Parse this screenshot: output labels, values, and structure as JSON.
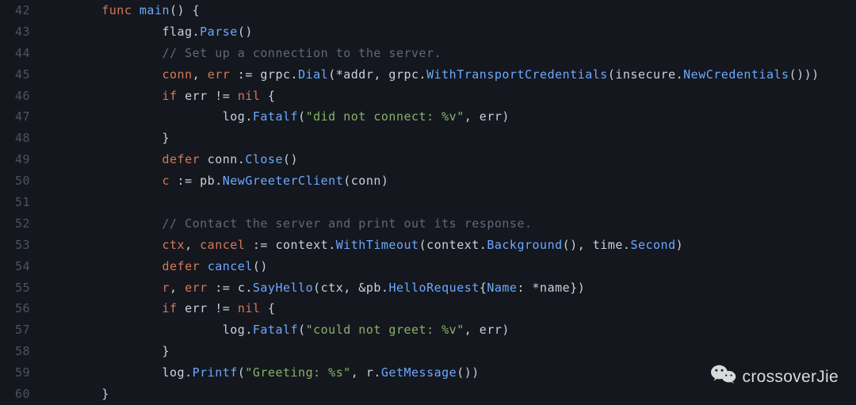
{
  "watermark": {
    "text": "crossoverJie"
  },
  "gutter": {
    "start": 42,
    "end": 60
  },
  "code": {
    "lines": [
      {
        "n": 42,
        "indent": 1,
        "tokens": [
          [
            "kw",
            "func"
          ],
          [
            "op",
            " "
          ],
          [
            "fn",
            "main"
          ],
          [
            "op",
            "() {"
          ]
        ]
      },
      {
        "n": 43,
        "indent": 2,
        "tokens": [
          [
            "ident",
            "flag"
          ],
          [
            "op",
            "."
          ],
          [
            "fn",
            "Parse"
          ],
          [
            "op",
            "()"
          ]
        ]
      },
      {
        "n": 44,
        "indent": 2,
        "tokens": [
          [
            "cmt",
            "// Set up a connection to the server."
          ]
        ]
      },
      {
        "n": 45,
        "indent": 2,
        "tokens": [
          [
            "redId",
            "conn"
          ],
          [
            "op",
            ", "
          ],
          [
            "redId",
            "err"
          ],
          [
            "op",
            " := "
          ],
          [
            "ident",
            "grpc"
          ],
          [
            "op",
            "."
          ],
          [
            "fn",
            "Dial"
          ],
          [
            "op",
            "(*addr, grpc."
          ],
          [
            "fn",
            "WithTransportCredentials"
          ],
          [
            "op",
            "(insecure."
          ],
          [
            "fn",
            "NewCredentials"
          ],
          [
            "op",
            "()))"
          ]
        ]
      },
      {
        "n": 46,
        "indent": 2,
        "tokens": [
          [
            "kw",
            "if"
          ],
          [
            "op",
            " "
          ],
          [
            "ident",
            "err"
          ],
          [
            "op",
            " != "
          ],
          [
            "redId",
            "nil"
          ],
          [
            "op",
            " {"
          ]
        ]
      },
      {
        "n": 47,
        "indent": 3,
        "tokens": [
          [
            "ident",
            "log"
          ],
          [
            "op",
            "."
          ],
          [
            "fn",
            "Fatalf"
          ],
          [
            "op",
            "("
          ],
          [
            "str",
            "\"did not connect: %v\""
          ],
          [
            "op",
            ", err)"
          ]
        ]
      },
      {
        "n": 48,
        "indent": 2,
        "tokens": [
          [
            "op",
            "}"
          ]
        ]
      },
      {
        "n": 49,
        "indent": 2,
        "tokens": [
          [
            "kw",
            "defer"
          ],
          [
            "op",
            " conn."
          ],
          [
            "fn",
            "Close"
          ],
          [
            "op",
            "()"
          ]
        ]
      },
      {
        "n": 50,
        "indent": 2,
        "tokens": [
          [
            "redId",
            "c"
          ],
          [
            "op",
            " := "
          ],
          [
            "ident",
            "pb"
          ],
          [
            "op",
            "."
          ],
          [
            "fn",
            "NewGreeterClient"
          ],
          [
            "op",
            "(conn)"
          ]
        ]
      },
      {
        "n": 51,
        "indent": 0,
        "tokens": []
      },
      {
        "n": 52,
        "indent": 2,
        "tokens": [
          [
            "cmt",
            "// Contact the server and print out its response."
          ]
        ]
      },
      {
        "n": 53,
        "indent": 2,
        "tokens": [
          [
            "redId",
            "ctx"
          ],
          [
            "op",
            ", "
          ],
          [
            "redId",
            "cancel"
          ],
          [
            "op",
            " := "
          ],
          [
            "ident",
            "context"
          ],
          [
            "op",
            "."
          ],
          [
            "fn",
            "WithTimeout"
          ],
          [
            "op",
            "(context."
          ],
          [
            "fn",
            "Background"
          ],
          [
            "op",
            "(), time."
          ],
          [
            "fn",
            "Second"
          ],
          [
            "op",
            ")"
          ]
        ]
      },
      {
        "n": 54,
        "indent": 2,
        "tokens": [
          [
            "kw",
            "defer"
          ],
          [
            "op",
            " "
          ],
          [
            "fn",
            "cancel"
          ],
          [
            "op",
            "()"
          ]
        ]
      },
      {
        "n": 55,
        "indent": 2,
        "tokens": [
          [
            "redId",
            "r"
          ],
          [
            "op",
            ", "
          ],
          [
            "redId",
            "err"
          ],
          [
            "op",
            " := "
          ],
          [
            "ident",
            "c"
          ],
          [
            "op",
            "."
          ],
          [
            "fn",
            "SayHello"
          ],
          [
            "op",
            "(ctx, &pb."
          ],
          [
            "fn",
            "HelloRequest"
          ],
          [
            "op",
            "{"
          ],
          [
            "type",
            "Name"
          ],
          [
            "op",
            ": *name})"
          ]
        ]
      },
      {
        "n": 56,
        "indent": 2,
        "tokens": [
          [
            "kw",
            "if"
          ],
          [
            "op",
            " "
          ],
          [
            "ident",
            "err"
          ],
          [
            "op",
            " != "
          ],
          [
            "redId",
            "nil"
          ],
          [
            "op",
            " {"
          ]
        ]
      },
      {
        "n": 57,
        "indent": 3,
        "tokens": [
          [
            "ident",
            "log"
          ],
          [
            "op",
            "."
          ],
          [
            "fn",
            "Fatalf"
          ],
          [
            "op",
            "("
          ],
          [
            "str",
            "\"could not greet: %v\""
          ],
          [
            "op",
            ", err)"
          ]
        ]
      },
      {
        "n": 58,
        "indent": 2,
        "tokens": [
          [
            "op",
            "}"
          ]
        ]
      },
      {
        "n": 59,
        "indent": 2,
        "tokens": [
          [
            "ident",
            "log"
          ],
          [
            "op",
            "."
          ],
          [
            "fn",
            "Printf"
          ],
          [
            "op",
            "("
          ],
          [
            "str",
            "\"Greeting: %s\""
          ],
          [
            "op",
            ", r."
          ],
          [
            "fn",
            "GetMessage"
          ],
          [
            "op",
            "())"
          ]
        ]
      },
      {
        "n": 60,
        "indent": 1,
        "tokens": [
          [
            "op",
            "}"
          ]
        ]
      }
    ],
    "indentUnit": "        "
  }
}
